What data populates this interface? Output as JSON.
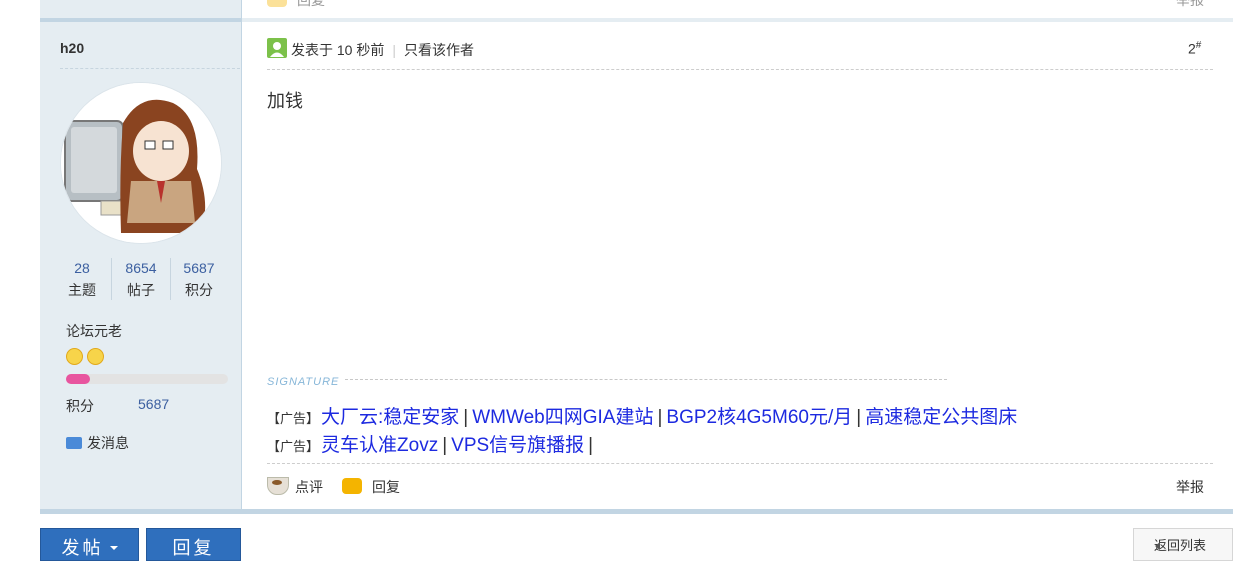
{
  "prev_footer": {
    "reply": "回复",
    "report": "举报"
  },
  "author": {
    "name": "h20",
    "stats": [
      {
        "value": "28",
        "label": "主题"
      },
      {
        "value": "8654",
        "label": "帖子"
      },
      {
        "value": "5687",
        "label": "积分"
      }
    ],
    "rank": "论坛元老",
    "credit_progress": 0.15,
    "credit_label": "积分",
    "credit_value": "5687",
    "message_label": "发消息"
  },
  "post": {
    "posted": "发表于 10 秒前",
    "sep": "|",
    "only_author": "只看该作者",
    "floor": "2",
    "floor_mark": "#",
    "content": "加钱"
  },
  "signature": {
    "label": "SIGNATURE",
    "ads": [
      {
        "tag": "【广告】",
        "links": [
          "大厂云:稳定安家",
          "WMWeb四网GIA建站",
          "BGP2核4G5M60元/月",
          "高速稳定公共图床"
        ],
        "trailing": ""
      },
      {
        "tag": "【广告】",
        "links": [
          "灵车认准Zovz",
          "VPS信号旗播报"
        ],
        "trailing": "|"
      }
    ]
  },
  "footer": {
    "comment": "点评",
    "reply": "回复",
    "report": "举报"
  },
  "buttons": {
    "post": "发帖",
    "reply": "回复",
    "back": "返回列表"
  },
  "colors": {
    "accent_blue": "#2f6fbd",
    "link": "#1d2ae0",
    "sidebar_bg": "#e5edf2",
    "progress": "#e8559f"
  }
}
